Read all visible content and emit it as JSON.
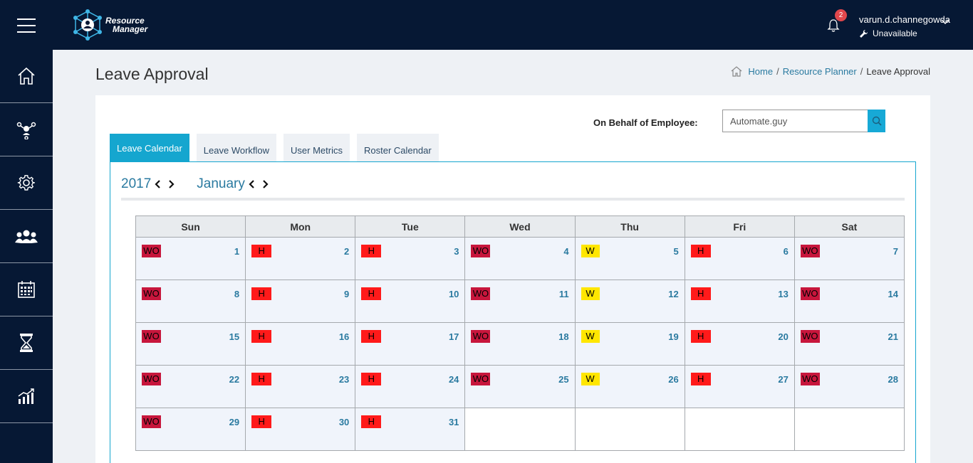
{
  "app": {
    "logo_line1": "Resource",
    "logo_line2": "Manager"
  },
  "notifications": {
    "count": "2"
  },
  "user": {
    "name": "varun.d.channegowda",
    "status": "Unavailable"
  },
  "sidebar": {
    "items": [
      {
        "icon": "home-icon"
      },
      {
        "icon": "network-icon"
      },
      {
        "icon": "gear-icon"
      },
      {
        "icon": "team-icon"
      },
      {
        "icon": "calendar-icon"
      },
      {
        "icon": "hourglass-icon"
      },
      {
        "icon": "chart-icon"
      }
    ]
  },
  "page": {
    "title": "Leave Approval"
  },
  "breadcrumb": {
    "home": "Home",
    "planner": "Resource Planner",
    "current": "Leave Approval",
    "sep": "/"
  },
  "behalf": {
    "label": "On Behalf of Employee:",
    "value": "Automate.guy"
  },
  "tabs": [
    "Leave Calendar",
    "Leave Workflow",
    "User Metrics",
    "Roster Calendar"
  ],
  "calendar": {
    "year": "2017",
    "month": "January",
    "weekdays": [
      "Sun",
      "Mon",
      "Tue",
      "Wed",
      "Thu",
      "Fri",
      "Sat"
    ],
    "weeks": [
      [
        {
          "tag": "WO",
          "day": "1"
        },
        {
          "tag": "H",
          "day": "2"
        },
        {
          "tag": "H",
          "day": "3"
        },
        {
          "tag": "WO",
          "day": "4"
        },
        {
          "tag": "W",
          "day": "5"
        },
        {
          "tag": "H",
          "day": "6"
        },
        {
          "tag": "WO",
          "day": "7"
        }
      ],
      [
        {
          "tag": "WO",
          "day": "8"
        },
        {
          "tag": "H",
          "day": "9"
        },
        {
          "tag": "H",
          "day": "10"
        },
        {
          "tag": "WO",
          "day": "11"
        },
        {
          "tag": "W",
          "day": "12"
        },
        {
          "tag": "H",
          "day": "13"
        },
        {
          "tag": "WO",
          "day": "14"
        }
      ],
      [
        {
          "tag": "WO",
          "day": "15"
        },
        {
          "tag": "H",
          "day": "16"
        },
        {
          "tag": "H",
          "day": "17"
        },
        {
          "tag": "WO",
          "day": "18"
        },
        {
          "tag": "W",
          "day": "19"
        },
        {
          "tag": "H",
          "day": "20"
        },
        {
          "tag": "WO",
          "day": "21"
        }
      ],
      [
        {
          "tag": "WO",
          "day": "22"
        },
        {
          "tag": "H",
          "day": "23"
        },
        {
          "tag": "H",
          "day": "24"
        },
        {
          "tag": "WO",
          "day": "25"
        },
        {
          "tag": "W",
          "day": "26"
        },
        {
          "tag": "H",
          "day": "27"
        },
        {
          "tag": "WO",
          "day": "28"
        }
      ],
      [
        {
          "tag": "WO",
          "day": "29"
        },
        {
          "tag": "H",
          "day": "30"
        },
        {
          "tag": "H",
          "day": "31"
        },
        null,
        null,
        null,
        null
      ]
    ]
  },
  "colors": {
    "navy": "#061834",
    "accent": "#15a6cf",
    "wo": "#c7163c",
    "h": "#ff1a1a",
    "w": "#ffe600"
  }
}
